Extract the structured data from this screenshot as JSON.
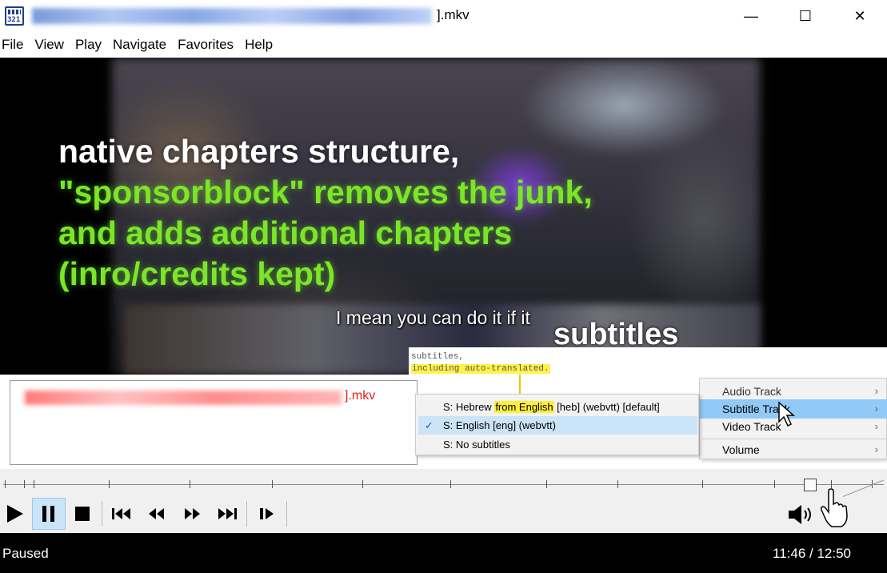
{
  "window": {
    "title_suffix": "].mkv",
    "minimize_glyph": "—",
    "maximize_glyph": "☐",
    "close_glyph": "✕",
    "icon_label": "321"
  },
  "menu": {
    "items": [
      "File",
      "View",
      "Play",
      "Navigate",
      "Favorites",
      "Help"
    ]
  },
  "video": {
    "overlay_lines": [
      {
        "text": "native chapters structure,",
        "color": "#ffffff"
      },
      {
        "text": "\"sponsorblock\" removes the junk,",
        "color": "#7be628"
      },
      {
        "text": "and adds additional chapters",
        "color": "#7be628"
      },
      {
        "text": "(inro/credits kept)",
        "color": "#7be628"
      }
    ],
    "subtitle_text": "I mean you can do it if it",
    "subtitles_label": "subtitles"
  },
  "annotation": {
    "line1": "subtitles,",
    "line2": "including auto-translated."
  },
  "playlist": {
    "entry_suffix": "].mkv"
  },
  "context_menu": {
    "items": [
      {
        "label": "Audio Track",
        "arrow": "›"
      },
      {
        "label": "Subtitle Track",
        "arrow": "›",
        "highlighted": true
      },
      {
        "label": "Video Track",
        "arrow": "›"
      },
      {
        "label": "Volume",
        "arrow": "›"
      }
    ]
  },
  "subtitle_submenu": {
    "hebrew_prefix": "S: Hebrew ",
    "hebrew_highlight": "from English",
    "hebrew_suffix": " [heb] (webvtt) [default]",
    "english": "S: English [eng] (webvtt)",
    "english_checked": true,
    "check_glyph": "✓",
    "none": "S: No subtitles"
  },
  "player": {
    "status": "Paused",
    "time": "11:46 / 12:50",
    "progress_fraction": 0.916
  },
  "colors": {
    "accent_highlight": "#91c9f7",
    "playlist_red": "#e0201a",
    "overlay_green": "#7be628",
    "annotation_yellow": "#fff34a"
  },
  "icons": [
    "app-icon",
    "play-icon",
    "pause-icon",
    "stop-icon",
    "skip-back-icon",
    "rewind-icon",
    "fast-forward-icon",
    "skip-forward-icon",
    "frame-step-icon",
    "speaker-icon",
    "hand-cursor-icon",
    "arrow-cursor-icon"
  ]
}
